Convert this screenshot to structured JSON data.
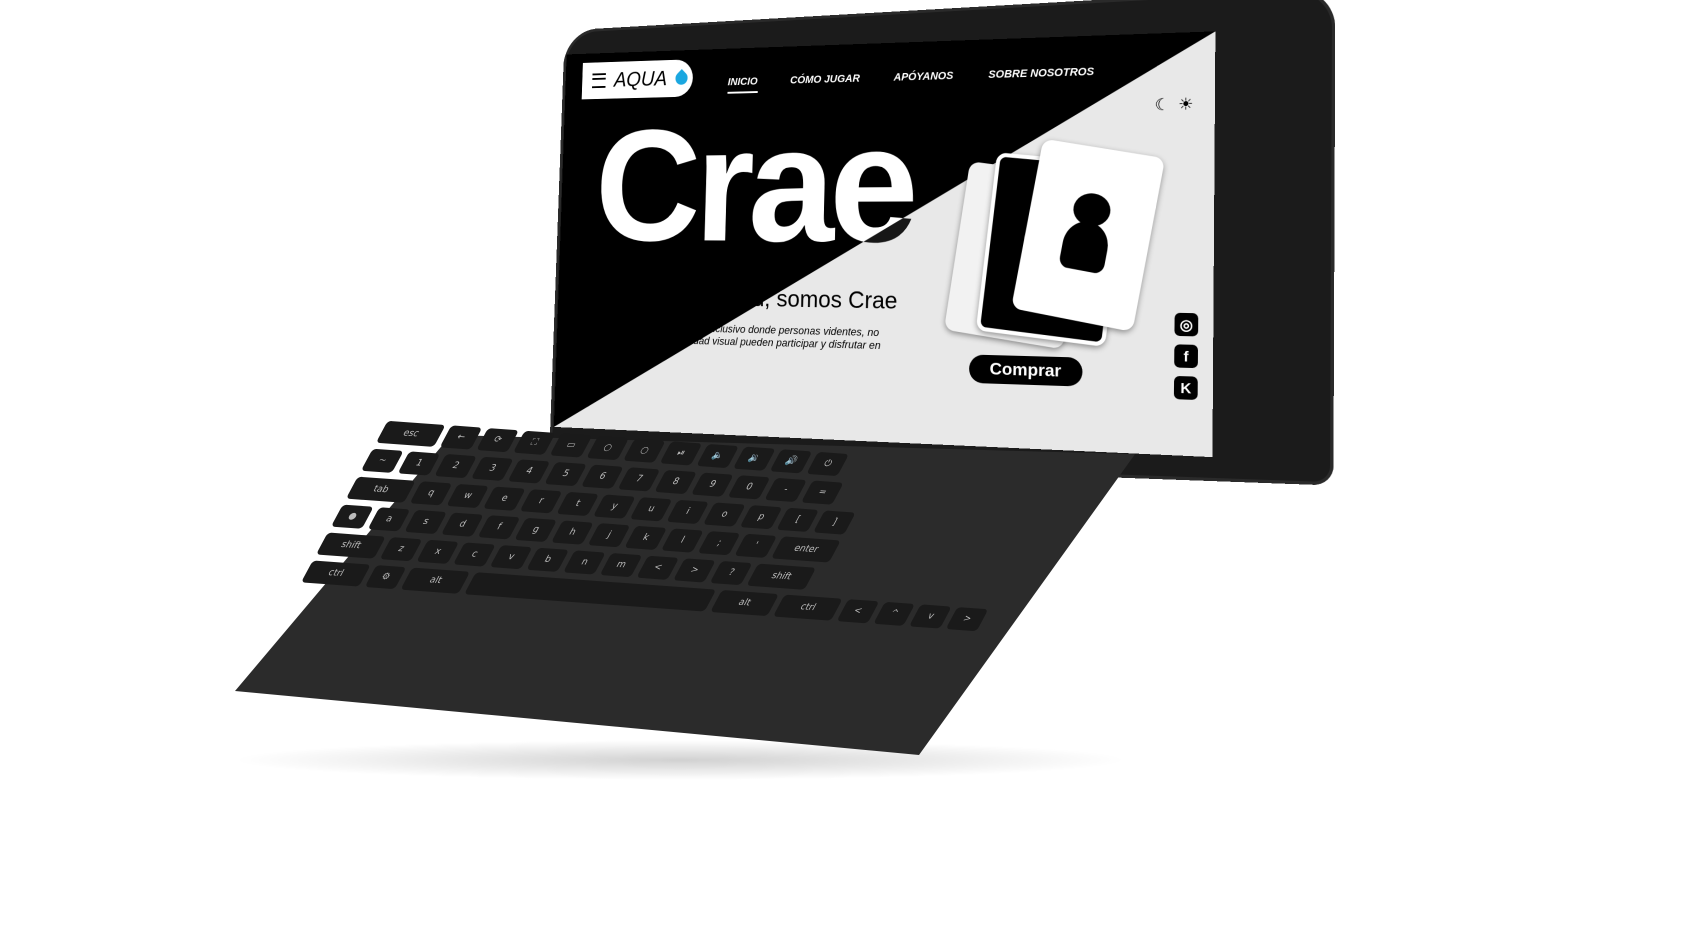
{
  "logo": {
    "text": "AQUA"
  },
  "nav": {
    "items": [
      {
        "label": "INICIO",
        "active": true
      },
      {
        "label": "CÓMO JUGAR",
        "active": false
      },
      {
        "label": "APÓYANOS",
        "active": false
      },
      {
        "label": "SOBRE NOSOTROS",
        "active": false
      }
    ]
  },
  "theme": {
    "moon_icon": "moon-icon",
    "sun_icon": "sun-icon"
  },
  "hero": {
    "title": "Crae",
    "subtitle": "Somos creatividad, somos Crae",
    "description": "Crae es un juego de cartas inclusivo donde personas videntes, no videntes y con discapacidad visual pueden participar y disfrutar en conjunto."
  },
  "cta": {
    "buy_label": "Comprar"
  },
  "social": [
    {
      "icon": "instagram-icon",
      "glyph": "◎"
    },
    {
      "icon": "facebook-icon",
      "glyph": "f"
    },
    {
      "icon": "kickstarter-icon",
      "glyph": "K"
    }
  ],
  "keyboard": {
    "rows": [
      [
        "esc",
        "←",
        "⟳",
        "⛶",
        "▭",
        "○",
        "○",
        "⏯",
        "🔈",
        "🔉",
        "🔊",
        "⏻"
      ],
      [
        "~",
        "1",
        "2",
        "3",
        "4",
        "5",
        "6",
        "7",
        "8",
        "9",
        "0",
        "-",
        "="
      ],
      [
        "tab",
        "q",
        "w",
        "e",
        "r",
        "t",
        "y",
        "u",
        "i",
        "o",
        "p",
        "[",
        "]"
      ],
      [
        "●",
        "a",
        "s",
        "d",
        "f",
        "g",
        "h",
        "j",
        "k",
        "l",
        ";",
        "'",
        "enter"
      ],
      [
        "shift",
        "z",
        "x",
        "c",
        "v",
        "b",
        "n",
        "m",
        "<",
        ">",
        "?",
        "shift"
      ],
      [
        "ctrl",
        "⚙",
        "alt",
        "",
        "alt",
        "ctrl",
        "<",
        "^",
        "v",
        ">"
      ]
    ]
  }
}
